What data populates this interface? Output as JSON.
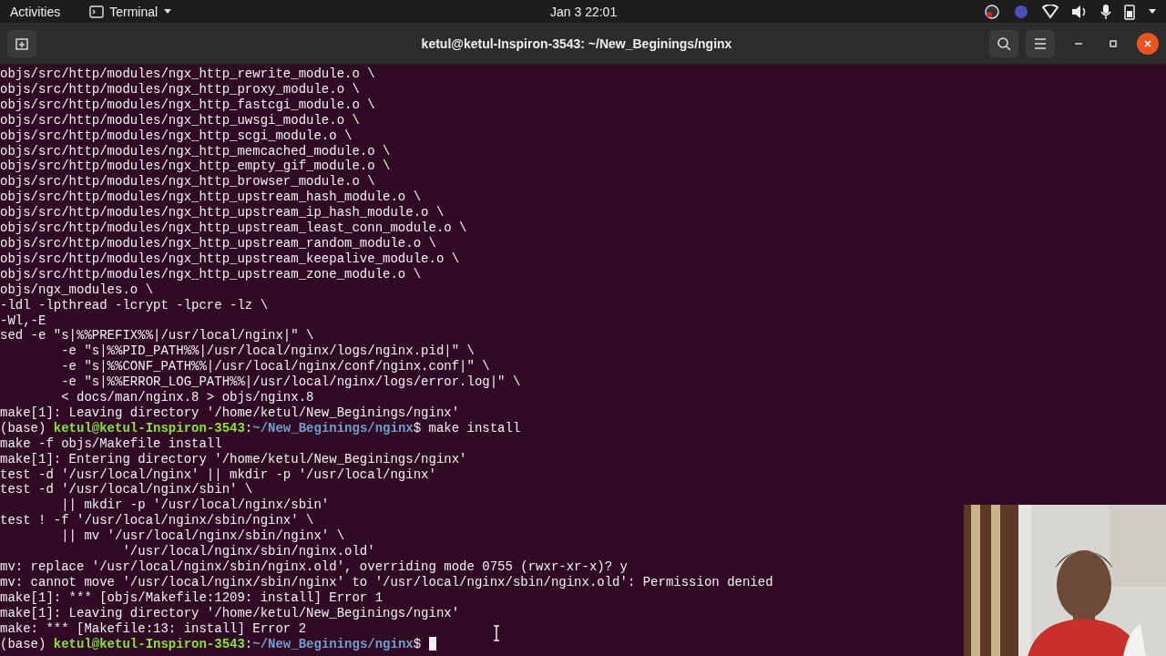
{
  "top_bar": {
    "activities": "Activities",
    "app_menu": "Terminal",
    "clock": "Jan 3  22:01"
  },
  "window": {
    "title": "ketul@ketul-Inspiron-3543: ~/New_Beginings/nginx"
  },
  "terminal": {
    "lines": [
      {
        "kind": "plain",
        "text": "objs/src/http/modules/ngx_http_rewrite_module.o \\"
      },
      {
        "kind": "plain",
        "text": "objs/src/http/modules/ngx_http_proxy_module.o \\"
      },
      {
        "kind": "plain",
        "text": "objs/src/http/modules/ngx_http_fastcgi_module.o \\"
      },
      {
        "kind": "plain",
        "text": "objs/src/http/modules/ngx_http_uwsgi_module.o \\"
      },
      {
        "kind": "plain",
        "text": "objs/src/http/modules/ngx_http_scgi_module.o \\"
      },
      {
        "kind": "plain",
        "text": "objs/src/http/modules/ngx_http_memcached_module.o \\"
      },
      {
        "kind": "plain",
        "text": "objs/src/http/modules/ngx_http_empty_gif_module.o \\"
      },
      {
        "kind": "plain",
        "text": "objs/src/http/modules/ngx_http_browser_module.o \\"
      },
      {
        "kind": "plain",
        "text": "objs/src/http/modules/ngx_http_upstream_hash_module.o \\"
      },
      {
        "kind": "plain",
        "text": "objs/src/http/modules/ngx_http_upstream_ip_hash_module.o \\"
      },
      {
        "kind": "plain",
        "text": "objs/src/http/modules/ngx_http_upstream_least_conn_module.o \\"
      },
      {
        "kind": "plain",
        "text": "objs/src/http/modules/ngx_http_upstream_random_module.o \\"
      },
      {
        "kind": "plain",
        "text": "objs/src/http/modules/ngx_http_upstream_keepalive_module.o \\"
      },
      {
        "kind": "plain",
        "text": "objs/src/http/modules/ngx_http_upstream_zone_module.o \\"
      },
      {
        "kind": "plain",
        "text": "objs/ngx_modules.o \\"
      },
      {
        "kind": "plain",
        "text": "-ldl -lpthread -lcrypt -lpcre -lz \\"
      },
      {
        "kind": "plain",
        "text": "-Wl,-E"
      },
      {
        "kind": "plain",
        "text": "sed -e \"s|%%PREFIX%%|/usr/local/nginx|\" \\"
      },
      {
        "kind": "plain",
        "text": "        -e \"s|%%PID_PATH%%|/usr/local/nginx/logs/nginx.pid|\" \\"
      },
      {
        "kind": "plain",
        "text": "        -e \"s|%%CONF_PATH%%|/usr/local/nginx/conf/nginx.conf|\" \\"
      },
      {
        "kind": "plain",
        "text": "        -e \"s|%%ERROR_LOG_PATH%%|/usr/local/nginx/logs/error.log|\" \\"
      },
      {
        "kind": "plain",
        "text": "        < docs/man/nginx.8 > objs/nginx.8"
      },
      {
        "kind": "plain",
        "text": "make[1]: Leaving directory '/home/ketul/New_Beginings/nginx'"
      },
      {
        "kind": "prompt",
        "env": "(base)",
        "user": "ketul@ketul-Inspiron-3543",
        "sep": ":",
        "path": "~/New_Beginings/nginx",
        "dollar": "$",
        "command": "make install",
        "cursor": false
      },
      {
        "kind": "plain",
        "text": "make -f objs/Makefile install"
      },
      {
        "kind": "plain",
        "text": "make[1]: Entering directory '/home/ketul/New_Beginings/nginx'"
      },
      {
        "kind": "plain",
        "text": "test -d '/usr/local/nginx' || mkdir -p '/usr/local/nginx'"
      },
      {
        "kind": "plain",
        "text": "test -d '/usr/local/nginx/sbin' \\"
      },
      {
        "kind": "plain",
        "text": "        || mkdir -p '/usr/local/nginx/sbin'"
      },
      {
        "kind": "plain",
        "text": "test ! -f '/usr/local/nginx/sbin/nginx' \\"
      },
      {
        "kind": "plain",
        "text": "        || mv '/usr/local/nginx/sbin/nginx' \\"
      },
      {
        "kind": "plain",
        "text": "                '/usr/local/nginx/sbin/nginx.old'"
      },
      {
        "kind": "plain",
        "text": "mv: replace '/usr/local/nginx/sbin/nginx.old', overriding mode 0755 (rwxr-xr-x)? y"
      },
      {
        "kind": "plain",
        "text": "mv: cannot move '/usr/local/nginx/sbin/nginx' to '/usr/local/nginx/sbin/nginx.old': Permission denied"
      },
      {
        "kind": "plain",
        "text": "make[1]: *** [objs/Makefile:1209: install] Error 1"
      },
      {
        "kind": "plain",
        "text": "make[1]: Leaving directory '/home/ketul/New_Beginings/nginx'"
      },
      {
        "kind": "plain",
        "text": "make: *** [Makefile:13: install] Error 2"
      },
      {
        "kind": "prompt",
        "env": "(base)",
        "user": "ketul@ketul-Inspiron-3543",
        "sep": ":",
        "path": "~/New_Beginings/nginx",
        "dollar": "$",
        "cursor": true
      }
    ]
  }
}
